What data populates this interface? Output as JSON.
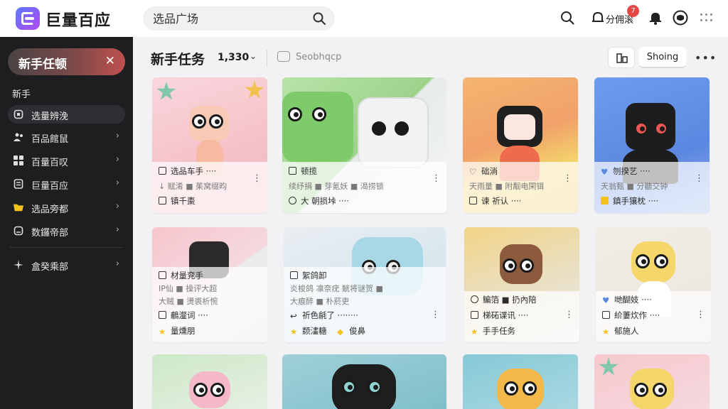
{
  "app": {
    "name": "巨量百应"
  },
  "search": {
    "placeholder": "选品广场"
  },
  "topbar": {
    "share_label": "分佣滚",
    "notif_count": "7"
  },
  "sidebar": {
    "active": {
      "label": "新手任顿"
    },
    "section": "新手",
    "items": [
      {
        "label": "选量辨浼",
        "selected": true,
        "icon": "square-icon",
        "chevron": false
      },
      {
        "label": "百品館鼠",
        "selected": false,
        "icon": "users-icon",
        "chevron": true
      },
      {
        "label": "百量百叹",
        "selected": false,
        "icon": "grid-icon",
        "chevron": true
      },
      {
        "label": "巨量百应",
        "selected": false,
        "icon": "document-icon",
        "chevron": true
      },
      {
        "label": "选品旁都",
        "selected": false,
        "icon": "folder-icon",
        "chevron": true
      },
      {
        "label": "数鑼帝部",
        "selected": false,
        "icon": "box-icon",
        "chevron": true
      },
      {
        "label": "盒癸乘部",
        "selected": false,
        "icon": "sparkle-icon",
        "chevron": true
      }
    ]
  },
  "header": {
    "title": "新手任务",
    "count": "1,330",
    "bot_label": "Seobhqcp",
    "showing_label": "Shoing"
  },
  "cards": [
    {
      "l1": "选品车手 ····",
      "l2": "↓ 赋淆 ■ 茱窝缀昀",
      "l3": "镇千棗",
      "i1": "task-icon",
      "i3": "bag-icon"
    },
    {
      "l1": "顿揽",
      "l2": "续纾捐 ■ 芽氪妖 ■ 渴捞锁",
      "l3": "大  朝损垰 ····",
      "i1": "bag-icon",
      "i3": "link-icon"
    },
    {
      "l1": "础淌",
      "l2": "天雨量 ■ 附觏电閑铒",
      "l3": "谏  祈认 ····",
      "i1": "heart-icon",
      "i3": "bag-icon"
    },
    {
      "l1": "刎揆艺 ····",
      "l2": "天翁甄 ■ 分聽交钟",
      "l3": "鎮手獽枕 ····",
      "i1": "heart-icon",
      "i3": "home-icon"
    },
    {
      "l1": "材量兖手",
      "l2": "IP仙 ■ 操评大超",
      "l3": "大贼 ■ 燙裘析惋",
      "i1": "task-icon",
      "i3": ""
    },
    {
      "l1": "絮鸽卸",
      "l2": "炎梭鸽 凛奈疣 觥将谜贺 ■",
      "l3": "大痕醉 ■ 朴菸吏",
      "i1": "task-icon",
      "i3": ""
    },
    {
      "l1": "鳊箔 ■ 扔內陪",
      "l2": "",
      "l3": "",
      "i1": "clock-icon",
      "i3": ""
    },
    {
      "l1": "哋醐妓 ····",
      "l2": "",
      "l3": "",
      "i1": "heart-icon",
      "i3": ""
    }
  ],
  "card_row2_extra": [
    {
      "a": "鵏瀣词 ····",
      "b": "量燻朋",
      "bi": "star-icon"
    },
    {
      "a": "祈色毹了 ········",
      "b": "颣澅糖",
      "b2": "俊鼻",
      "bi": "star-icon"
    },
    {
      "a": "梯砳谍讯 ····",
      "b": "手手任务",
      "bi": "star-icon"
    },
    {
      "a": "紒萋炊作 ····",
      "b": "郁施人",
      "bi": "star-icon"
    }
  ],
  "colors": {
    "accent_red": "#e84545",
    "sidebar_bg": "#1e1e20",
    "brand_purple": "#8b5cf6"
  }
}
